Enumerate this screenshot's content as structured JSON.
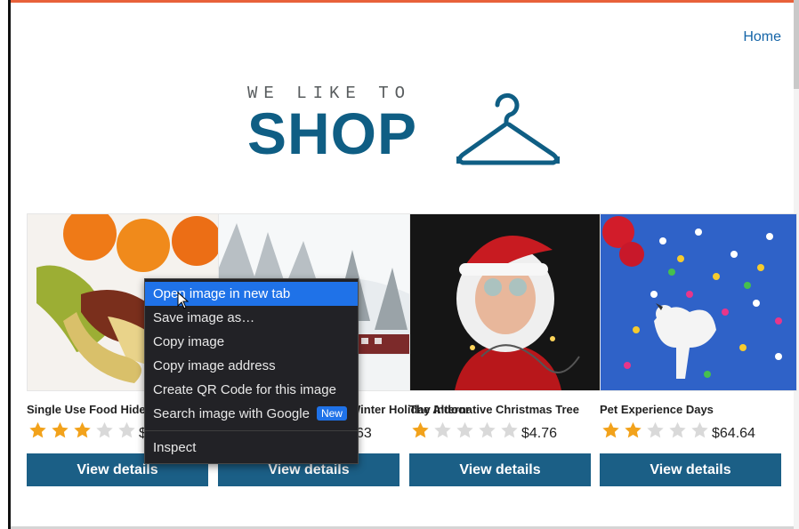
{
  "nav": {
    "home": "Home"
  },
  "logo": {
    "tagline": "WE LIKE TO",
    "word": "SHOP"
  },
  "colors": {
    "brand": "#0f5e84",
    "button": "#1b5f86",
    "link": "#1565a8",
    "star_on": "#f2a21b",
    "star_off": "#d9d9d9",
    "menu_highlight": "#1f72e8"
  },
  "products": [
    {
      "title": "Single Use Food Hider",
      "rating": 3,
      "price": "$",
      "button": "View details"
    },
    {
      "title": "Winter Holiday Indoor",
      "rating": 0,
      "price": "63",
      "button": "View details"
    },
    {
      "title": "The Alternative Christmas Tree",
      "rating": 1,
      "price": "$4.76",
      "button": "View details"
    },
    {
      "title": "Pet Experience Days",
      "rating": 2,
      "price": "$64.64",
      "button": "View details"
    }
  ],
  "context_menu": {
    "items": [
      "Open image in new tab",
      "Save image as…",
      "Copy image",
      "Copy image address",
      "Create QR Code for this image",
      "Search image with Google",
      "Inspect"
    ],
    "new_badge": "New"
  }
}
